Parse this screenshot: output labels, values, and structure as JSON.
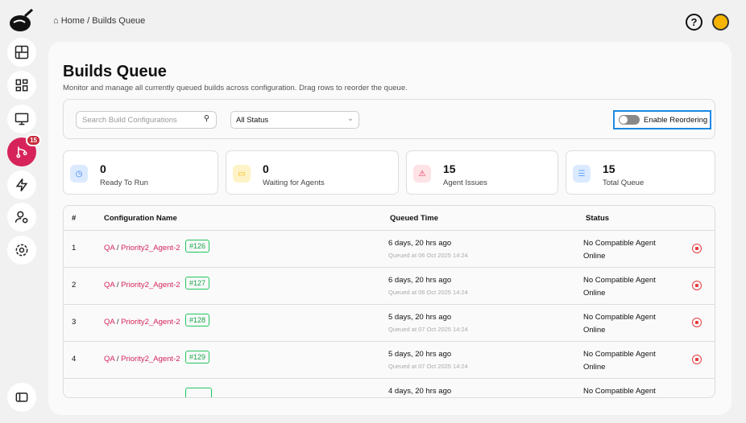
{
  "breadcrumb": {
    "home": "Home",
    "separator": "/",
    "current": "Builds Queue"
  },
  "sidebar": {
    "badge": "15",
    "items": [
      "dashboard",
      "overview",
      "monitor",
      "builds-queue",
      "actions",
      "user-settings",
      "settings"
    ]
  },
  "page": {
    "title": "Builds Queue",
    "subtitle": "Monitor and manage all currently queued builds across configuration. Drag rows to reorder the queue."
  },
  "filters": {
    "search_placeholder": "Search Build Configurations",
    "status_selected": "All Status",
    "toggle_label": "Enable Reordering",
    "toggle_on": false
  },
  "stats": [
    {
      "value": "0",
      "label": "Ready To Run",
      "color": "#3b82f6"
    },
    {
      "value": "0",
      "label": "Waiting for Agents",
      "color": "#f5b400"
    },
    {
      "value": "15",
      "label": "Agent Issues",
      "color": "#e11d48"
    },
    {
      "value": "15",
      "label": "Total Queue",
      "color": "#60a5fa"
    }
  ],
  "table": {
    "headers": [
      "#",
      "Configuration Name",
      "Queued Time",
      "Status"
    ],
    "rows": [
      {
        "num": "1",
        "project": "QA",
        "config": "Priority2_Agent-2",
        "build": "#126",
        "ago": "6 days, 20 hrs ago",
        "queued": "Queued at 06 Oct 2025 14:24",
        "status": "No Compatible Agent Online"
      },
      {
        "num": "2",
        "project": "QA",
        "config": "Priority2_Agent-2",
        "build": "#127",
        "ago": "6 days, 20 hrs ago",
        "queued": "Queued at 06 Oct 2025 14:24",
        "status": "No Compatible Agent Online"
      },
      {
        "num": "3",
        "project": "QA",
        "config": "Priority2_Agent-2",
        "build": "#128",
        "ago": "5 days, 20 hrs ago",
        "queued": "Queued at 07 Oct 2025 14:24",
        "status": "No Compatible Agent Online"
      },
      {
        "num": "4",
        "project": "QA",
        "config": "Priority2_Agent-2",
        "build": "#129",
        "ago": "5 days, 20 hrs ago",
        "queued": "Queued at 07 Oct 2025 14:24",
        "status": "No Compatible Agent Online"
      },
      {
        "ago": "4 days, 20 hrs ago",
        "status": "No Compatible Agent"
      }
    ]
  }
}
